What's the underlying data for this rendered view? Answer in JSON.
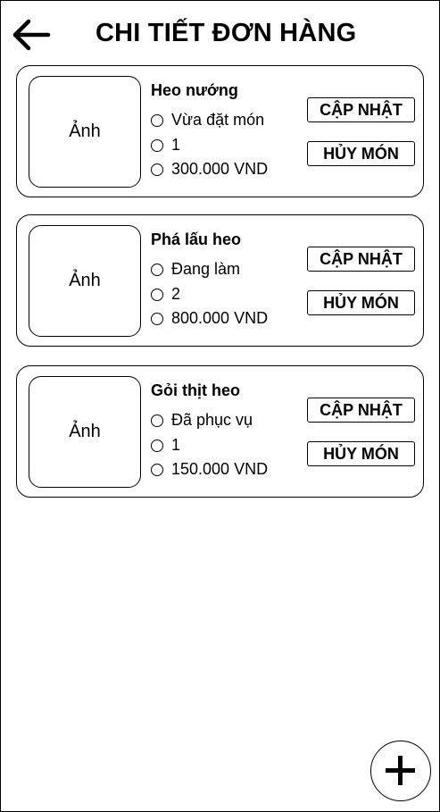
{
  "header": {
    "back_icon": "arrow-left-icon",
    "title": "CHI TIẾT ĐƠN HÀNG"
  },
  "items": [
    {
      "photo_label": "Ảnh",
      "name": "Heo nướng",
      "status": "Vừa đặt món",
      "quantity": "1",
      "price": "300.000 VND",
      "update_label": "CẬP NHẬT",
      "cancel_label": "HỦY MÓN"
    },
    {
      "photo_label": "Ảnh",
      "name": "Phá lấu heo",
      "status": "Đang làm",
      "quantity": "2",
      "price": "800.000 VND",
      "update_label": "CẬP NHẬT",
      "cancel_label": "HỦY MÓN"
    },
    {
      "photo_label": "Ảnh",
      "name": "Gỏi thịt heo",
      "status": "Đã phục vụ",
      "quantity": "1",
      "price": "150.000 VND",
      "update_label": "CẬP NHẬT",
      "cancel_label": "HỦY MÓN"
    }
  ],
  "fab": {
    "icon": "plus-icon"
  }
}
